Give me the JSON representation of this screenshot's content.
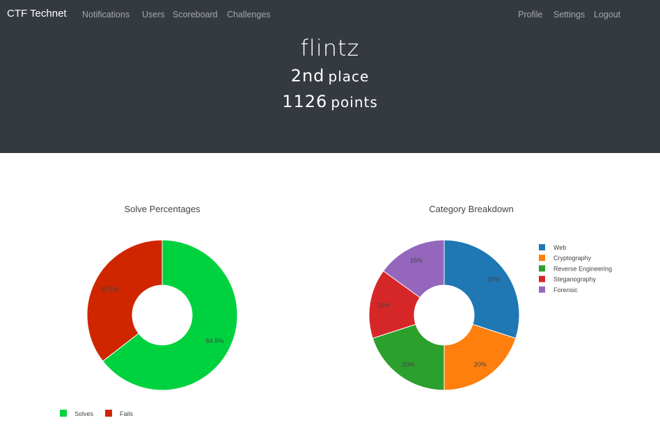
{
  "navbar": {
    "brand": "CTF Technet",
    "left_links": [
      "Notifications",
      "Users",
      "Scoreboard",
      "Challenges"
    ],
    "right_links": [
      "Profile",
      "Settings",
      "Logout"
    ]
  },
  "profile": {
    "name": "flintz",
    "place_number": "2nd",
    "place_label": "place",
    "points_number": "1126",
    "points_label": "points"
  },
  "colors": {
    "header_bg": "#343a40",
    "solves": "#00d13f",
    "fails": "#cf2600",
    "web": "#1f77b4",
    "cryptography": "#ff7f0e",
    "reverse_engineering": "#2ca02c",
    "steganography": "#d62728",
    "forensic": "#9467bd"
  },
  "chart_data": [
    {
      "type": "pie",
      "title": "Solve Percentages",
      "categories": [
        "Solves",
        "Fails"
      ],
      "values": [
        64.5,
        35.5
      ],
      "labels": [
        "64.5%",
        "35.5%"
      ],
      "colors": [
        "#00d13f",
        "#cf2600"
      ],
      "legend_placement": "bottom"
    },
    {
      "type": "pie",
      "title": "Category Breakdown",
      "categories": [
        "Web",
        "Cryptography",
        "Reverse Engineering",
        "Steganography",
        "Forensic"
      ],
      "values": [
        30,
        20,
        20,
        15,
        15
      ],
      "labels": [
        "30%",
        "20%",
        "20%",
        "15%",
        "15%"
      ],
      "colors": [
        "#1f77b4",
        "#ff7f0e",
        "#2ca02c",
        "#d62728",
        "#9467bd"
      ],
      "legend_placement": "right"
    }
  ]
}
